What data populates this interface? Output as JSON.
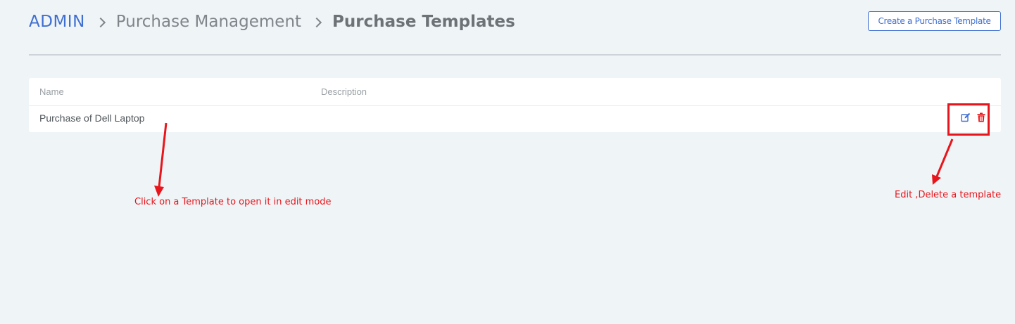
{
  "breadcrumb": {
    "root": "ADMIN",
    "section": "Purchase Management",
    "current": "Purchase Templates"
  },
  "toolbar": {
    "create_label": "Create a Purchase Template"
  },
  "table": {
    "columns": [
      "Name",
      "Description"
    ],
    "rows": [
      {
        "name": "Purchase of Dell Laptop",
        "description": "",
        "actions": [
          "edit-icon",
          "trash-icon"
        ]
      }
    ]
  },
  "annotations": {
    "click_hint": "Click on a Template to open it in edit mode",
    "actions_hint": "Edit ,Delete a template"
  },
  "colors": {
    "accent": "#3f6fd1",
    "annotation": "#e8161c",
    "background": "#eff4f7"
  }
}
